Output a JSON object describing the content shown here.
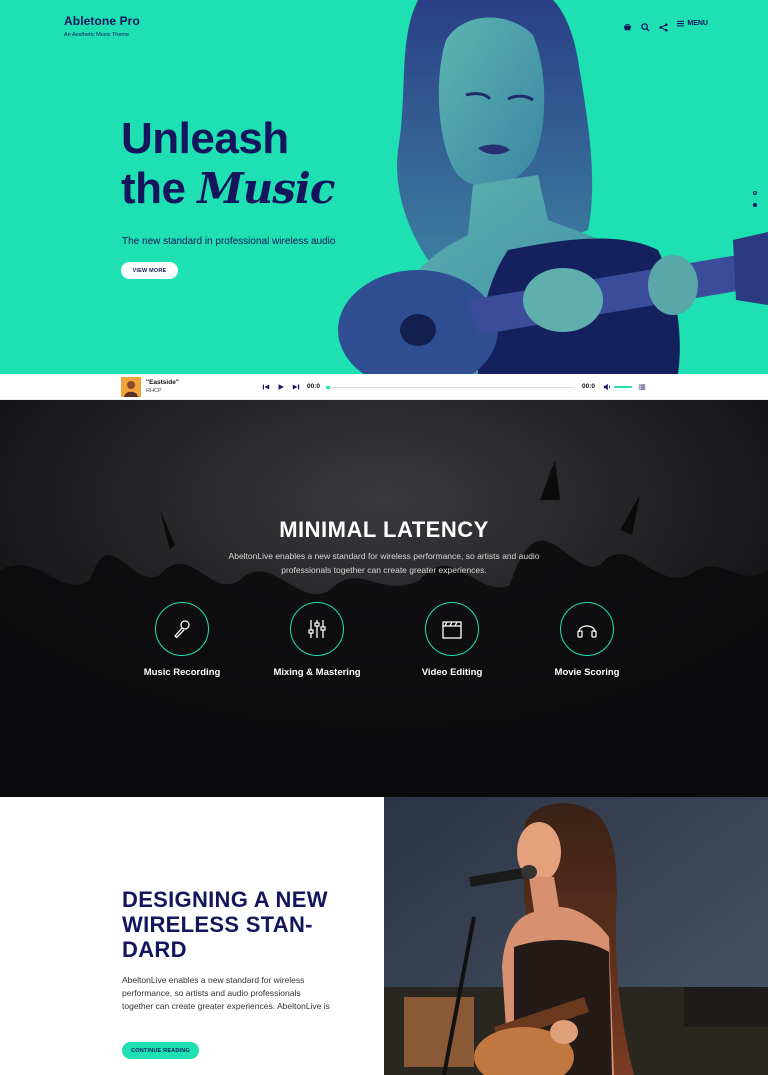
{
  "colors": {
    "accent": "#1ee0b2",
    "navy": "#14155c",
    "dark": "#141416"
  },
  "brand": {
    "title": "Abletone Pro",
    "subtitle": "An Aesthetic Music Theme"
  },
  "nav": {
    "menu_label": "MENU",
    "icons": [
      "cart-icon",
      "search-icon",
      "share-icon",
      "hamburger-icon"
    ]
  },
  "hero": {
    "title_line1": "Unleash",
    "title_line2_prefix": "the",
    "title_line2_script": "Music",
    "subtitle": "The new standard in professional wireless audio",
    "button": "VIEW MORE",
    "slides": 2,
    "active_slide": 2
  },
  "player": {
    "track_title": "\"Eastside\"",
    "artist": "RHCP",
    "time_elapsed": "00:0",
    "time_total": "00:0",
    "progress": 0.0,
    "volume": 1.0
  },
  "features_section": {
    "title": "MINIMAL LATENCY",
    "text": "AbeltonLive enables a new standard for wireless performance, so artists and audio professionals together can create greater experiences.",
    "items": [
      {
        "label": "Music Recording",
        "icon": "microphone-icon"
      },
      {
        "label": "Mixing & Mastering",
        "icon": "sliders-icon"
      },
      {
        "label": "Video Editing",
        "icon": "clapperboard-icon"
      },
      {
        "label": "Movie Scoring",
        "icon": "headphones-icon"
      }
    ]
  },
  "article": {
    "title": "DESIGNING A NEW WIRELESS STAN-DARD",
    "text": "AbeltonLive enables a new standard for wireless performance, so artists and audio professionals together can create greater experiences. AbeltonLive is",
    "button": "CONTINUE READING"
  }
}
